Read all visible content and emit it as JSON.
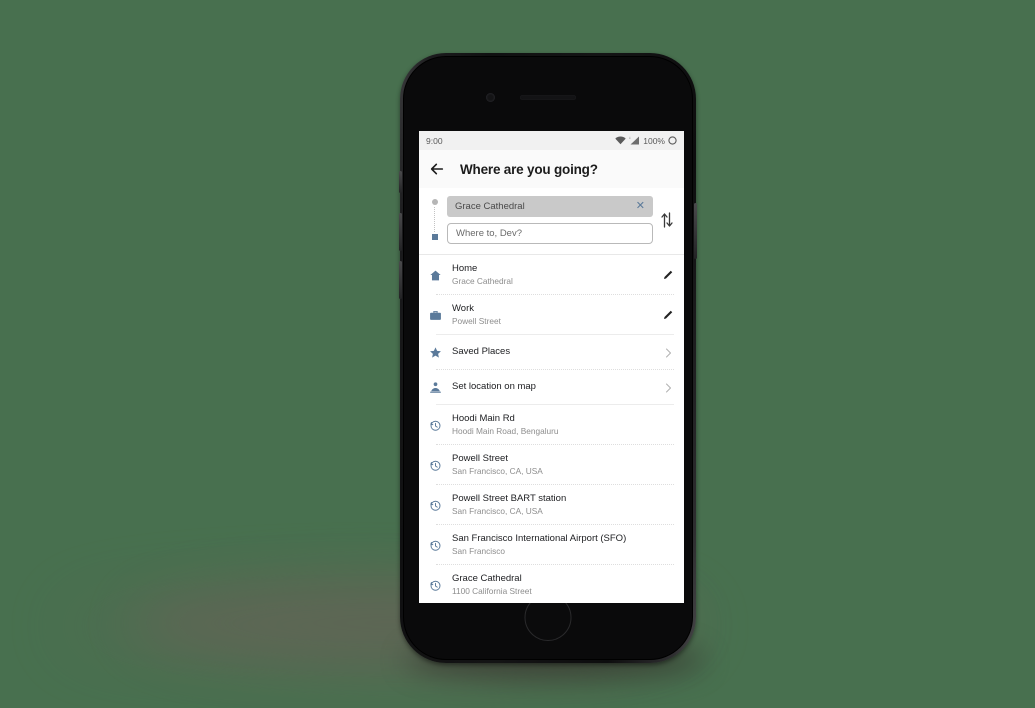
{
  "theme": {
    "page_background": "#48704f",
    "icon_blue": "#5b7a9a",
    "accent_blue": "#5b7a9a",
    "title_color": "#1c1c1c",
    "subtitle_color": "#8d8d8d"
  },
  "status_bar": {
    "time": "9:00",
    "battery_percent": "100%",
    "wifi_icon": "wifi-icon",
    "signal_icon": "cell-signal-icon",
    "battery_icon": "battery-icon"
  },
  "app_bar": {
    "back_icon": "back-arrow-icon",
    "title": "Where are you going?"
  },
  "search": {
    "origin": {
      "value": "Grace Cathedral",
      "clear_icon": "close-icon"
    },
    "destination": {
      "value": "",
      "placeholder": "Where to, Dev?"
    },
    "swap_icon": "swap-vertical-icon",
    "rail_start_icon": "origin-dot-icon",
    "rail_end_icon": "destination-square-icon"
  },
  "shortcuts": [
    {
      "icon": "home-icon",
      "title": "Home",
      "subtitle": "Grace Cathedral",
      "action_icon": "pencil-icon"
    },
    {
      "icon": "briefcase-icon",
      "title": "Work",
      "subtitle": "Powell Street",
      "action_icon": "pencil-icon"
    }
  ],
  "actions": [
    {
      "icon": "star-icon",
      "title": "Saved Places",
      "action_icon": "chevron-right-icon"
    },
    {
      "icon": "person-pin-icon",
      "title": "Set location on map",
      "action_icon": "chevron-right-icon"
    }
  ],
  "recent_places": [
    {
      "icon": "history-icon",
      "title": "Hoodi Main Rd",
      "subtitle": "Hoodi Main Road, Bengaluru"
    },
    {
      "icon": "history-icon",
      "title": "Powell Street",
      "subtitle": "San Francisco, CA, USA"
    },
    {
      "icon": "history-icon",
      "title": "Powell Street BART station",
      "subtitle": "San Francisco, CA, USA"
    },
    {
      "icon": "history-icon",
      "title": "San Francisco International Airport (SFO)",
      "subtitle": "San Francisco"
    },
    {
      "icon": "history-icon",
      "title": "Grace Cathedral",
      "subtitle": "1100 California Street"
    }
  ]
}
